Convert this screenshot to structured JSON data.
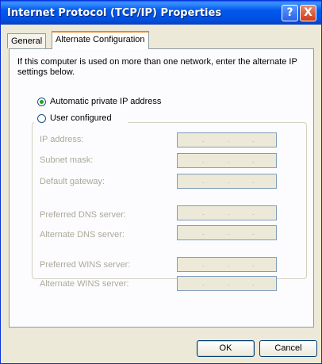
{
  "window": {
    "title": "Internet Protocol (TCP/IP) Properties",
    "help": "?",
    "close": "X"
  },
  "tabs": [
    {
      "label": "General"
    },
    {
      "label": "Alternate Configuration"
    }
  ],
  "description": "If this computer is used on more than one network, enter the alternate IP settings below.",
  "radios": {
    "automatic": "Automatic private IP address",
    "user": "User configured"
  },
  "fields": [
    {
      "label": "IP address:"
    },
    {
      "label": "Subnet mask:"
    },
    {
      "label": "Default gateway:"
    },
    {
      "label": "Preferred DNS server:"
    },
    {
      "label": "Alternate DNS server:"
    },
    {
      "label": "Preferred WINS server:"
    },
    {
      "label": "Alternate WINS server:"
    }
  ],
  "ip_dot": ".",
  "buttons": {
    "ok": "OK",
    "cancel": "Cancel"
  }
}
